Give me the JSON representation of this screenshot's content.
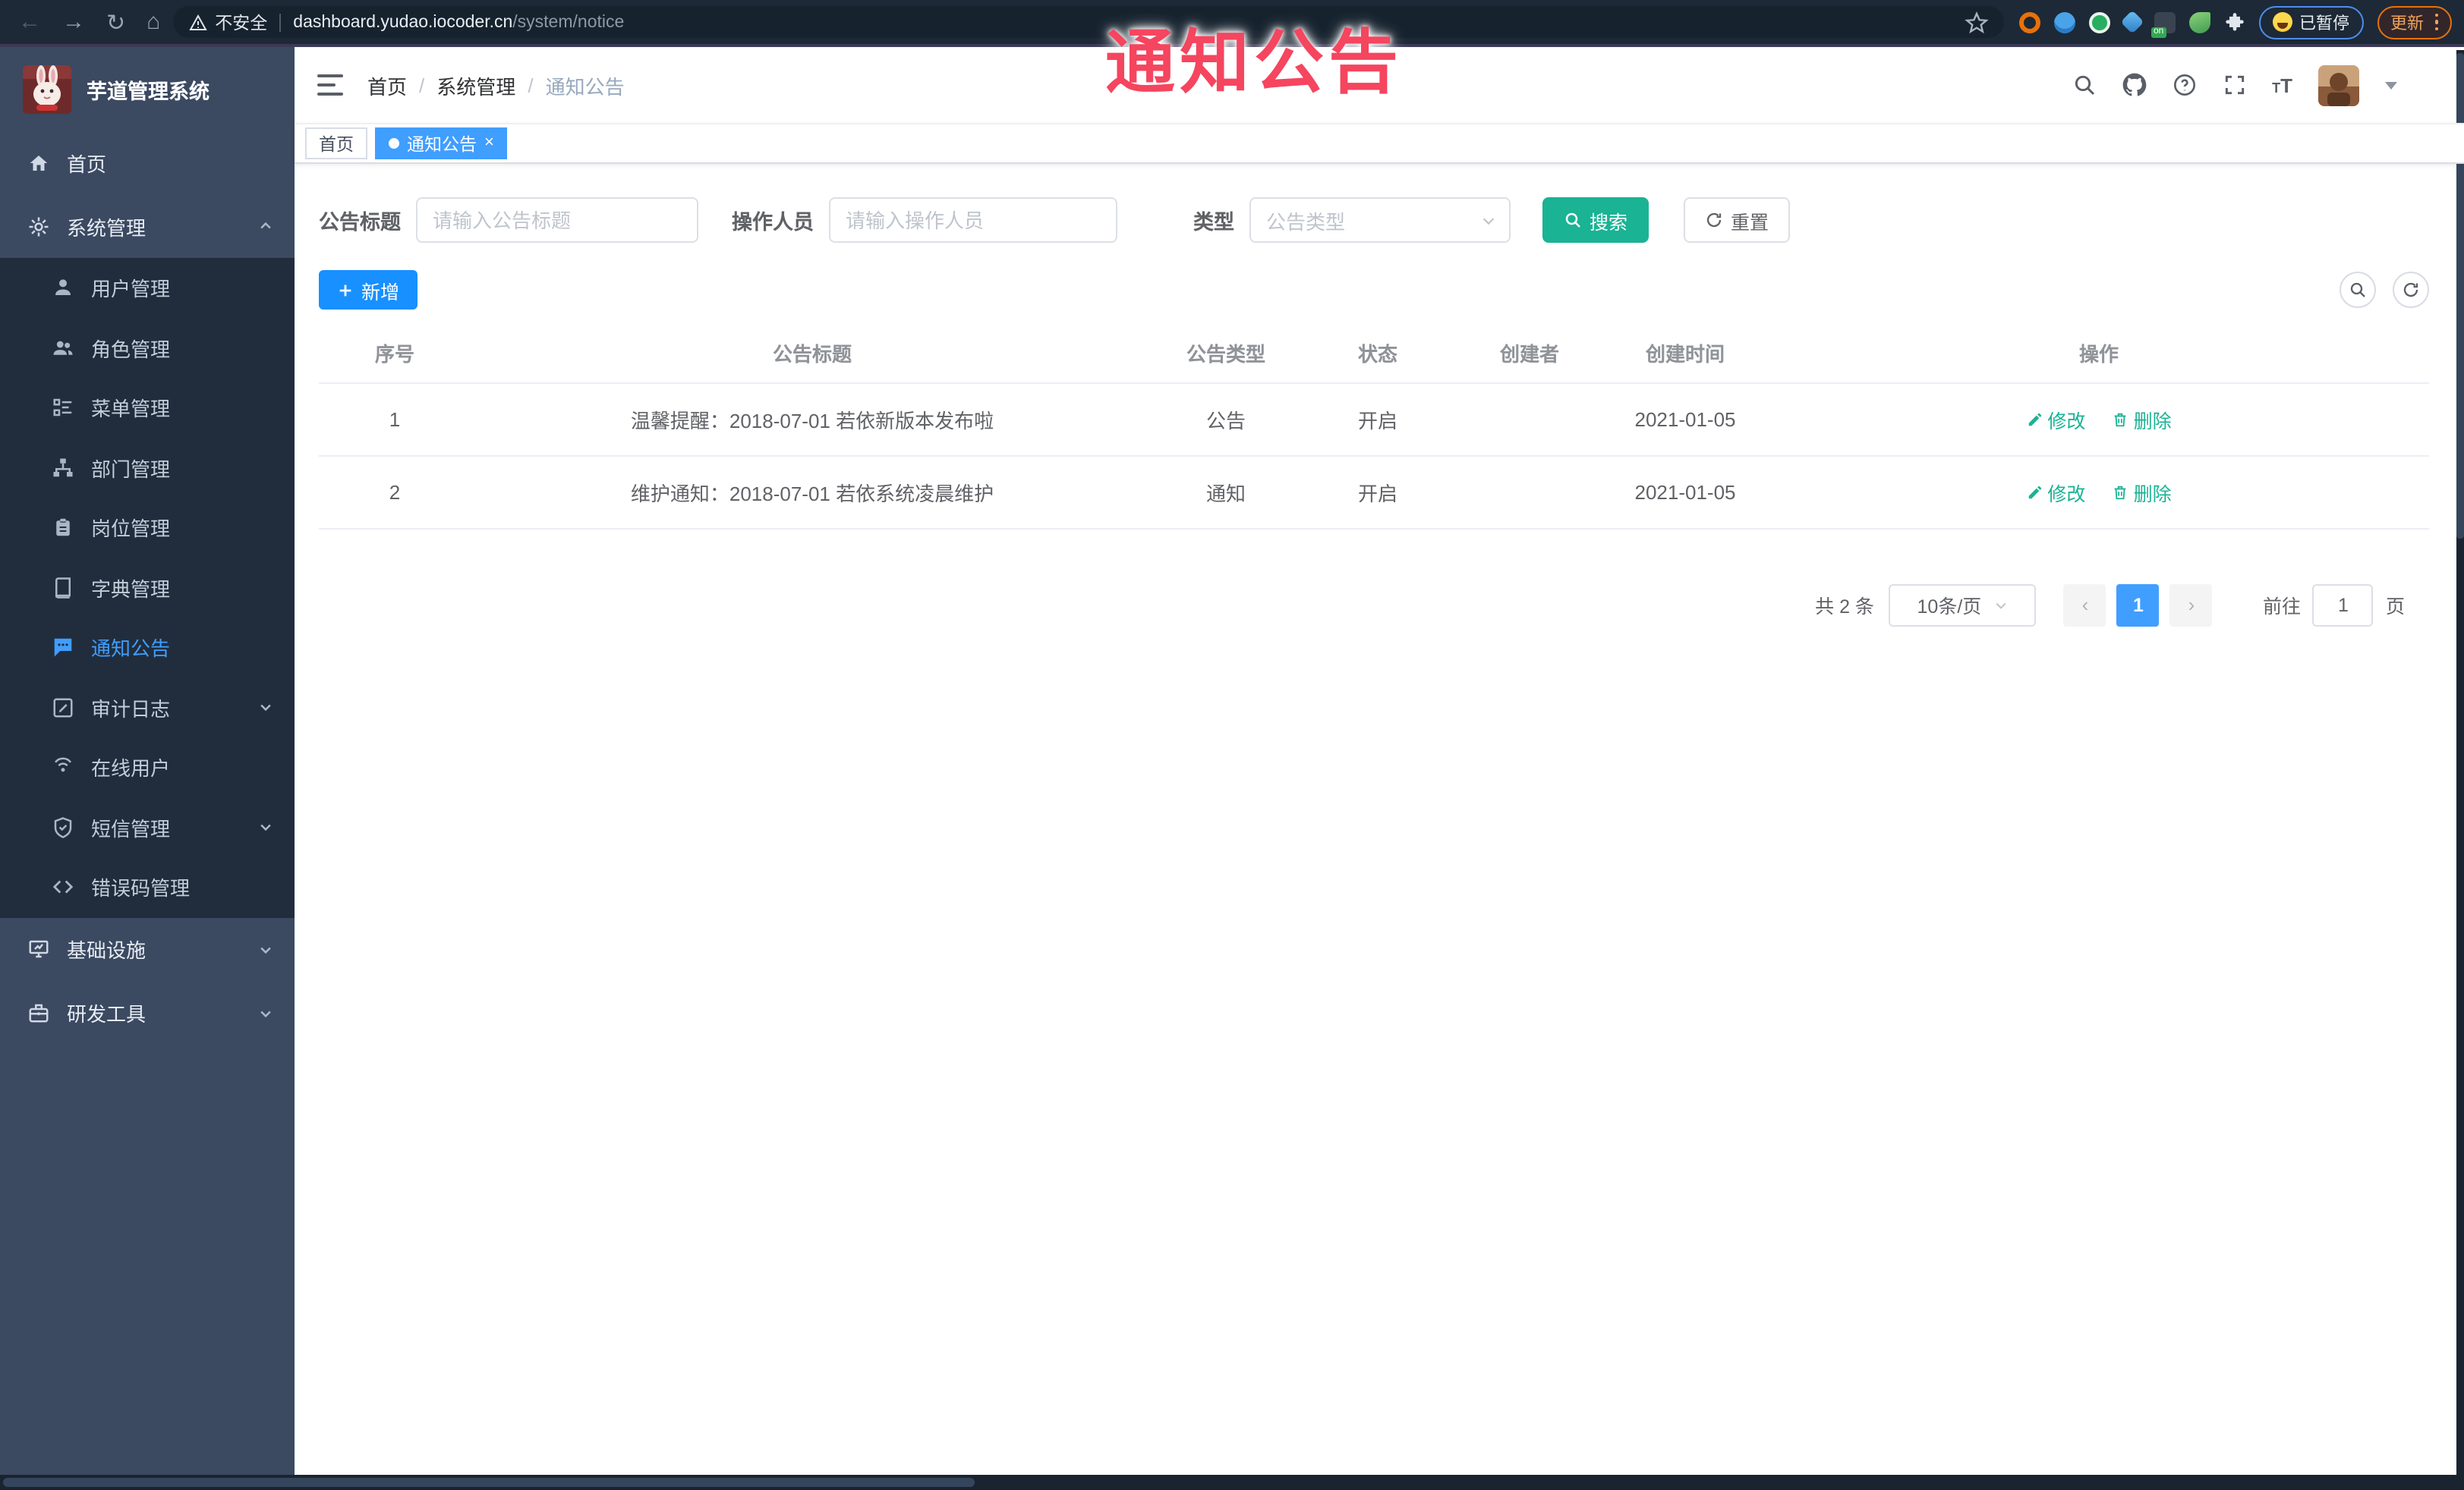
{
  "browser": {
    "security_label": "不安全",
    "url_host": "dashboard.yudao.iocoder.cn",
    "url_path": "/system/notice",
    "extension_on_badge": "on",
    "paused_label": "已暂停",
    "update_label": "更新"
  },
  "watermark": "通知公告",
  "sidebar": {
    "title": "芋道管理系统",
    "items": [
      {
        "label": "首页"
      },
      {
        "label": "系统管理"
      },
      {
        "label": "用户管理"
      },
      {
        "label": "角色管理"
      },
      {
        "label": "菜单管理"
      },
      {
        "label": "部门管理"
      },
      {
        "label": "岗位管理"
      },
      {
        "label": "字典管理"
      },
      {
        "label": "通知公告"
      },
      {
        "label": "审计日志"
      },
      {
        "label": "在线用户"
      },
      {
        "label": "短信管理"
      },
      {
        "label": "错误码管理"
      },
      {
        "label": "基础设施"
      },
      {
        "label": "研发工具"
      }
    ]
  },
  "navbar": {
    "breadcrumb": [
      "首页",
      "系统管理",
      "通知公告"
    ]
  },
  "tabs": [
    {
      "label": "首页"
    },
    {
      "label": "通知公告",
      "close": "×"
    }
  ],
  "filter": {
    "title_label": "公告标题",
    "title_placeholder": "请输入公告标题",
    "operator_label": "操作人员",
    "operator_placeholder": "请输入操作人员",
    "type_label": "类型",
    "type_placeholder": "公告类型",
    "search_label": "搜索",
    "reset_label": "重置"
  },
  "toolbar": {
    "add_label": "新增"
  },
  "table": {
    "columns": [
      "序号",
      "公告标题",
      "公告类型",
      "状态",
      "创建者",
      "创建时间",
      "操作"
    ],
    "rows": [
      {
        "no": "1",
        "title": "温馨提醒：2018-07-01 若依新版本发布啦",
        "type": "公告",
        "status": "开启",
        "creator": "",
        "created": "2021-01-05"
      },
      {
        "no": "2",
        "title": "维护通知：2018-07-01 若依系统凌晨维护",
        "type": "通知",
        "status": "开启",
        "creator": "",
        "created": "2021-01-05"
      }
    ],
    "actions": {
      "edit": "修改",
      "delete": "删除"
    }
  },
  "pagination": {
    "total": "共 2 条",
    "page_size": "10条/页",
    "current_page": "1",
    "goto_label": "前往",
    "goto_value": "1",
    "unit_label": "页"
  },
  "colors": {
    "accent_blue": "#409eff",
    "add_button_blue": "#1890ff",
    "search_button_teal": "#1ab394",
    "active_tab_blue": "#409eff",
    "watermark_red": "#f5455f",
    "sidebar_bg": "#3b4961",
    "submenu_bg": "#212d3d",
    "chrome_bg": "#1d2936"
  }
}
